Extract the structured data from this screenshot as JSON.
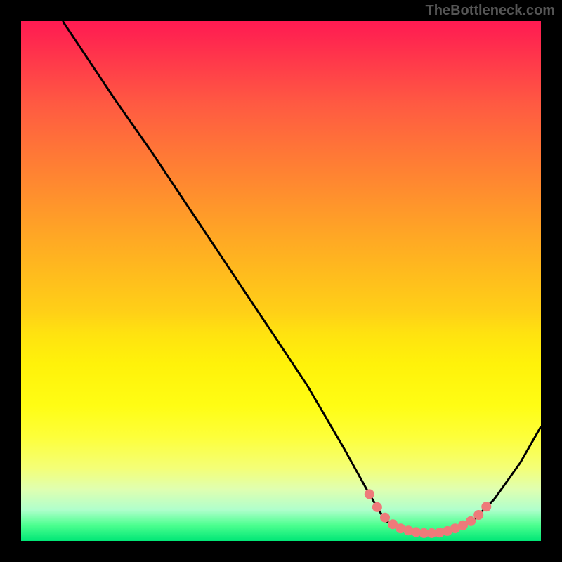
{
  "watermark": "TheBottleneck.com",
  "chart_data": {
    "type": "line",
    "title": "",
    "xlabel": "",
    "ylabel": "",
    "xlim": [
      0,
      100
    ],
    "ylim": [
      0,
      100
    ],
    "series": [
      {
        "name": "curve",
        "points": [
          {
            "x": 8,
            "y": 100
          },
          {
            "x": 12,
            "y": 94
          },
          {
            "x": 18,
            "y": 85
          },
          {
            "x": 25,
            "y": 75
          },
          {
            "x": 35,
            "y": 60
          },
          {
            "x": 45,
            "y": 45
          },
          {
            "x": 55,
            "y": 30
          },
          {
            "x": 62,
            "y": 18
          },
          {
            "x": 67,
            "y": 9
          },
          {
            "x": 70,
            "y": 4
          },
          {
            "x": 73,
            "y": 2
          },
          {
            "x": 78,
            "y": 1.5
          },
          {
            "x": 83,
            "y": 2
          },
          {
            "x": 87,
            "y": 4
          },
          {
            "x": 91,
            "y": 8
          },
          {
            "x": 96,
            "y": 15
          },
          {
            "x": 100,
            "y": 22
          }
        ]
      }
    ],
    "highlight_dots": [
      {
        "x": 67,
        "y": 9
      },
      {
        "x": 68.5,
        "y": 6.5
      },
      {
        "x": 70,
        "y": 4.5
      },
      {
        "x": 71.5,
        "y": 3.2
      },
      {
        "x": 73,
        "y": 2.4
      },
      {
        "x": 74.5,
        "y": 2.0
      },
      {
        "x": 76,
        "y": 1.7
      },
      {
        "x": 77.5,
        "y": 1.5
      },
      {
        "x": 79,
        "y": 1.5
      },
      {
        "x": 80.5,
        "y": 1.6
      },
      {
        "x": 82,
        "y": 1.9
      },
      {
        "x": 83.5,
        "y": 2.4
      },
      {
        "x": 85,
        "y": 3.0
      },
      {
        "x": 86.5,
        "y": 3.8
      },
      {
        "x": 88,
        "y": 5.0
      },
      {
        "x": 89.5,
        "y": 6.6
      }
    ],
    "colors": {
      "curve": "#000000",
      "dots": "#ee7a7a"
    }
  }
}
